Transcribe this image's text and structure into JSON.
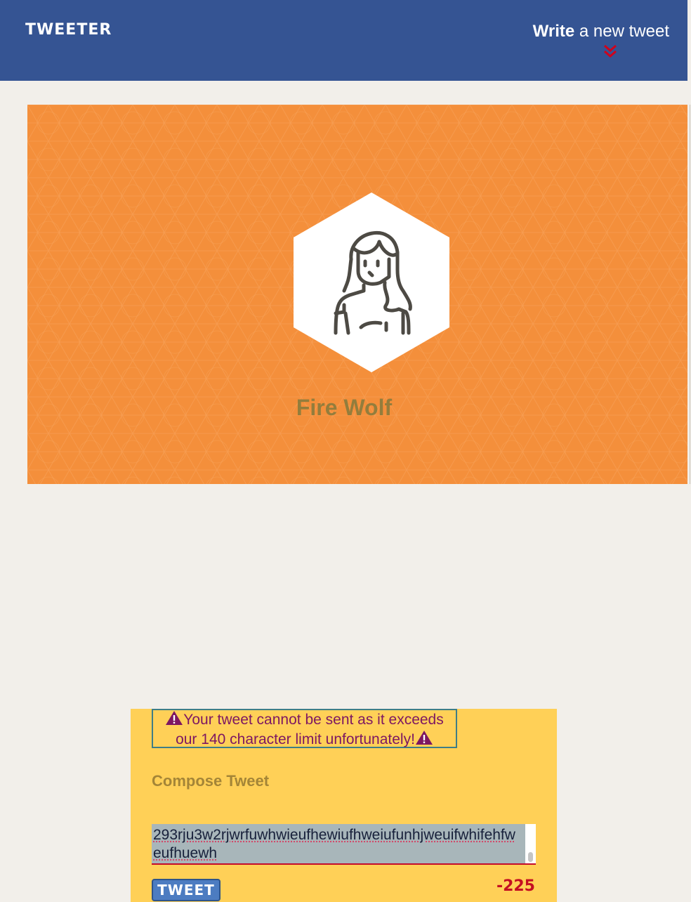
{
  "header": {
    "brand": "TWEETER",
    "write_strong": "Write",
    "write_rest": " a new tweet"
  },
  "profile": {
    "name": "Fire Wolf",
    "avatar_icon": "woman-avatar-icon"
  },
  "compose": {
    "error_line1": "Your tweet cannot be sent as it exceeds",
    "error_line2": "our 140 character limit unfortunately!",
    "label": "Compose Tweet",
    "tweet_text": "293rju3w2rjwrfuwhwieufhewiufhweiufunhjweuifwhifehfweufhuewh",
    "button_label": "TWEET",
    "char_counter": "-225"
  },
  "colors": {
    "nav_bg": "#355493",
    "hero_bg": "#f48f3b",
    "compose_bg": "#ffd057",
    "error_text": "#7d1762",
    "counter_red": "#c40f22"
  }
}
